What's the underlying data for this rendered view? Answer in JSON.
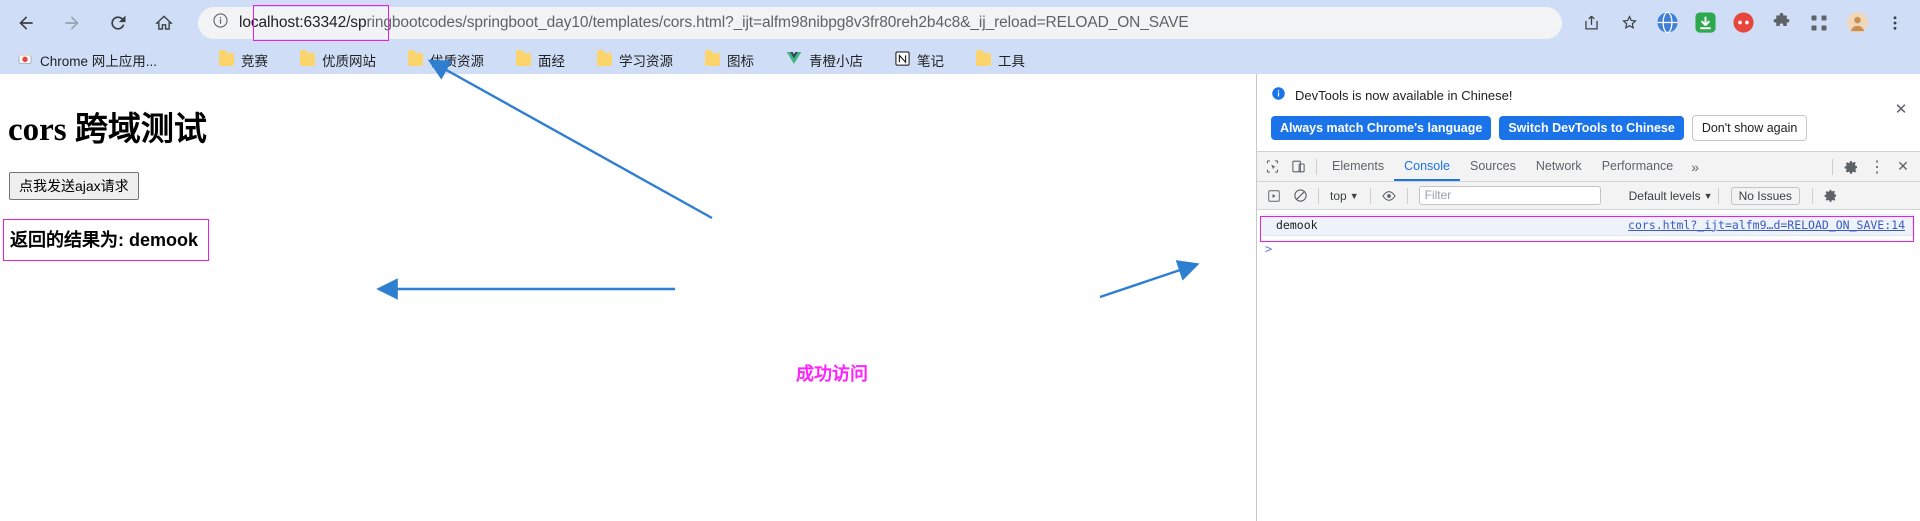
{
  "browser": {
    "nav": {
      "back_label": "Back",
      "forward_label": "Forward",
      "reload_label": "Reload",
      "home_label": "Home"
    },
    "omnibox": {
      "info_icon": "site-info-icon",
      "url_host": "localhost:63342/sp",
      "url_rest": "ringbootcodes/springboot_day10/templates/cors.html?_ijt=alfm98nibpg8v3fr80reh2b4c8&_ij_reload=RELOAD_ON_SAVE",
      "full_url": "localhost:63342/springbootcodes/springboot_day10/templates/cors.html?_ijt=alfm98nibpg8v3fr80reh2b4c8&_ij_reload=RELOAD_ON_SAVE",
      "share_icon": "share-icon",
      "bookmark_icon": "star-icon"
    },
    "extensions": [
      {
        "name": "extension-blue-globe",
        "color": "#3f7fd6"
      },
      {
        "name": "extension-green-download",
        "color": "#2ea84f"
      },
      {
        "name": "extension-red-circle",
        "color": "#e8453c"
      },
      {
        "name": "extension-puzzle",
        "color": "#5f6368"
      },
      {
        "name": "extension-grid",
        "color": "#5f6368"
      },
      {
        "name": "profile-avatar",
        "color": "#d49a6a"
      },
      {
        "name": "chrome-menu",
        "color": "#5f6368"
      }
    ],
    "bookmarks": [
      {
        "label": "Chrome 网上应用...",
        "icon": "chrome-webstore-icon"
      },
      {
        "label": "竞赛",
        "icon": "folder-icon"
      },
      {
        "label": "优质网站",
        "icon": "folder-icon"
      },
      {
        "label": "优质资源",
        "icon": "folder-icon"
      },
      {
        "label": "面经",
        "icon": "folder-icon"
      },
      {
        "label": "学习资源",
        "icon": "folder-icon"
      },
      {
        "label": "图标",
        "icon": "folder-icon"
      },
      {
        "label": "青橙小店",
        "icon": "vue-icon"
      },
      {
        "label": "笔记",
        "icon": "notion-icon"
      },
      {
        "label": "工具",
        "icon": "folder-icon"
      }
    ]
  },
  "page": {
    "heading": "cors 跨域测试",
    "button_label": "点我发送ajax请求",
    "result_text": "返回的结果为: demook",
    "annotation": "成功访问"
  },
  "devtools": {
    "banner": {
      "message": "DevTools is now available in Chinese!",
      "info_icon": "info-circle-icon",
      "primary_button": "Always match Chrome's language",
      "secondary_button": "Switch DevTools to Chinese",
      "dismiss_button": "Don't show again",
      "close_icon": "close-icon",
      "close_label": "✕"
    },
    "tabs": [
      {
        "label": "Elements",
        "active": false
      },
      {
        "label": "Console",
        "active": true
      },
      {
        "label": "Sources",
        "active": false
      },
      {
        "label": "Network",
        "active": false
      },
      {
        "label": "Performance",
        "active": false
      }
    ],
    "more_tabs_label": "»",
    "inspect_icon": "inspect-element-icon",
    "device_icon": "device-toolbar-icon",
    "settings_icon": "gear-icon",
    "kebab_icon": "more-vertical-icon",
    "close_icon": "close-icon",
    "close_label": "✕",
    "kebab_label": "⋮",
    "filterbar": {
      "execute_icon": "execute-snippet-icon",
      "clear_icon": "clear-console-icon",
      "context_label": "top",
      "context_caret": "▼",
      "eye_icon": "live-expression-icon",
      "filter_placeholder": "Filter",
      "levels_label": "Default levels",
      "levels_caret": "▼",
      "issues_label": "No Issues",
      "settings_icon": "gear-icon"
    },
    "console": {
      "message": "demook",
      "source_link": "cors.html?_ijt=alfm9…d=RELOAD_ON_SAVE:14",
      "prompt_symbol": ">"
    }
  },
  "colors": {
    "chrome_toolbar": "#cfdef6",
    "accent_blue": "#1a73e8",
    "annotation_magenta": "#e81ee8",
    "arrow_blue": "#2f7fd0"
  }
}
